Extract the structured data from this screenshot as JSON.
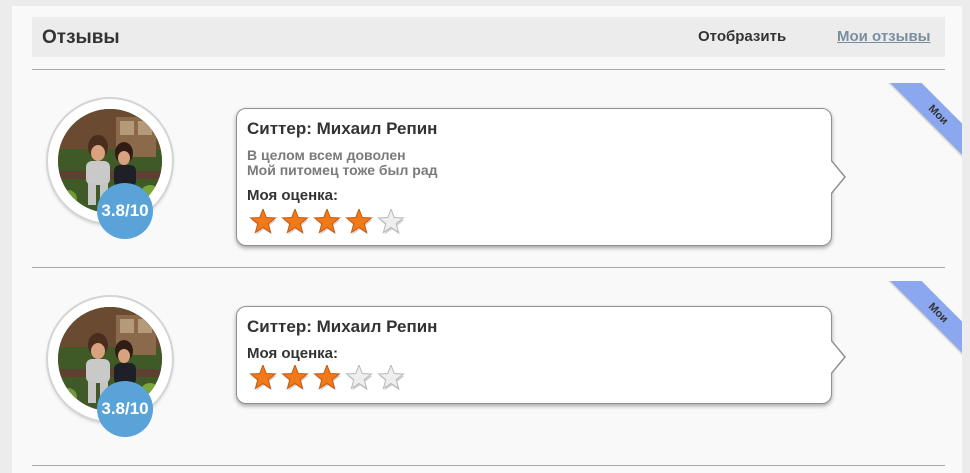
{
  "header": {
    "title": "Отзывы",
    "display_label": "Отобразить",
    "my_reviews_link": "Мои отзывы"
  },
  "reviews": [
    {
      "sitter": "Ситтер: Михаил Репин",
      "comment_lines": [
        "В целом всем доволен",
        "Мой питомец тоже был рад"
      ],
      "rating_label": "Моя оценка:",
      "my_stars": 4,
      "max_stars": 5,
      "sitter_rating": "3.8/10",
      "ribbon": "Мои"
    },
    {
      "sitter": "Ситтер: Михаил Репин",
      "comment_lines": [],
      "rating_label": "Моя оценка:",
      "my_stars": 3,
      "max_stars": 5,
      "sitter_rating": "3.8/10",
      "ribbon": "Мои"
    }
  ],
  "colors": {
    "star_filled": "#f07a1a",
    "star_empty": "#eeeeee",
    "rating_badge": "#5aa3d8",
    "ribbon": "#8aa7ef",
    "link": "#7a8ea0"
  },
  "icons": {
    "star_filled": "star-filled-icon",
    "star_empty": "star-empty-icon"
  }
}
